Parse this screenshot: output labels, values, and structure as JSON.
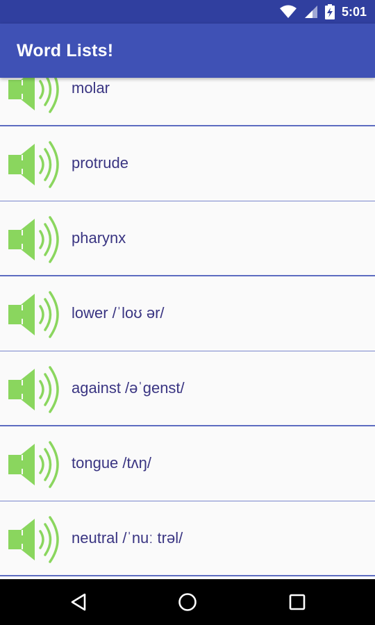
{
  "status_bar": {
    "time": "5:01",
    "icons": [
      "wifi-icon",
      "cell-signal-icon",
      "battery-charging-icon"
    ]
  },
  "app_bar": {
    "title": "Word Lists!",
    "color": "#3f51b5",
    "status_color": "#303f9f"
  },
  "colors": {
    "speaker": "#8ad65e",
    "word_text": "#3a3582",
    "divider": "#5c6bc0"
  },
  "words": [
    {
      "label": "molar",
      "icon": "speaker-icon"
    },
    {
      "label": "protrude",
      "icon": "speaker-icon"
    },
    {
      "label": "pharynx",
      "icon": "speaker-icon"
    },
    {
      "label": "lower /ˈloʊ ər/",
      "icon": "speaker-icon"
    },
    {
      "label": "against /əˈgenst/",
      "icon": "speaker-icon"
    },
    {
      "label": "tongue /tʌŋ/",
      "icon": "speaker-icon"
    },
    {
      "label": "neutral /ˈnuː trəl/",
      "icon": "speaker-icon"
    }
  ],
  "nav_bar": {
    "buttons": [
      "back-icon",
      "home-icon",
      "recents-icon"
    ]
  }
}
